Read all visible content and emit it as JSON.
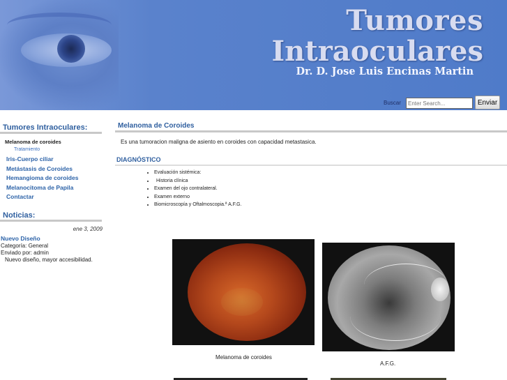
{
  "header": {
    "title_line1": "Tumores",
    "title_line2": "Intraoculares",
    "subtitle": "Dr. D. Jose Luis Encinas Martin",
    "search_label": "Buscar",
    "search_placeholder": "Enter Search...",
    "search_button": "Enviar"
  },
  "sidebar": {
    "heading": "Tumores Intraoculares:",
    "active_item": "Melanoma de coroides",
    "active_subitem": "Tratamiento",
    "items": [
      {
        "label": "Iris-Cuerpo ciliar"
      },
      {
        "label": "Metástasis de Coroides"
      },
      {
        "label": "Hemangioma de coroides"
      },
      {
        "label": "Melanocitoma de Papila"
      },
      {
        "label": "Contactar"
      }
    ],
    "news_heading": "Noticias:",
    "news": {
      "date": "ene 3, 2009",
      "title": "Nuevo Diseño",
      "category": "Categoría: General",
      "author": "Enviado por: admin",
      "text": "Nuevo diseño, mayor accesibilidad."
    }
  },
  "main": {
    "title": "Melanoma de Coroides",
    "intro": "Es una tumoracion maligna de asiento en coroides con capacidad metastasica.",
    "diagnosis_heading": "DIAGNÓSTICO",
    "diagnosis_items": [
      "Evaluación sistémica:",
      "Historia clínica",
      "Examen del ojo contralateral.",
      "Examen externo",
      "Biomicroscopía y Oftalmoscopia.ª A.F.G."
    ],
    "figures": [
      {
        "caption": "Melanoma de coroides"
      },
      {
        "caption": "A.F.G."
      }
    ]
  },
  "colors": {
    "header_blue": "#4f7bc9",
    "link_blue": "#2d63a8",
    "heading_blue": "#2f5f9f",
    "rule_gray": "#c8c8c8"
  }
}
